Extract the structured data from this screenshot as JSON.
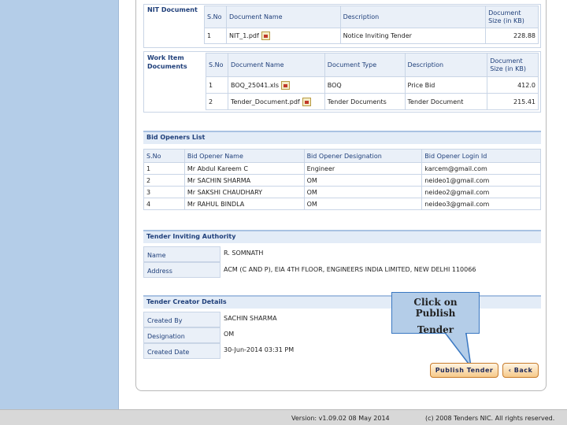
{
  "nit_document": {
    "section_label": "NIT Document",
    "headers": [
      "S.No",
      "Document Name",
      "Description",
      "Document Size (in KB)"
    ],
    "rows": [
      {
        "sno": "1",
        "name": "NIT_1.pdf",
        "description": "Notice Inviting Tender",
        "size": "228.88"
      }
    ]
  },
  "work_item_documents": {
    "section_label": "Work Item Documents",
    "headers": [
      "S.No",
      "Document Name",
      "Document Type",
      "Description",
      "Document Size (in KB)"
    ],
    "rows": [
      {
        "sno": "1",
        "name": "BOQ_25041.xls",
        "type": "BOQ",
        "description": "Price Bid",
        "size": "412.0"
      },
      {
        "sno": "2",
        "name": "Tender_Document.pdf",
        "type": "Tender Documents",
        "description": "Tender Document",
        "size": "215.41"
      }
    ]
  },
  "bid_openers": {
    "title": "Bid Openers List",
    "headers": [
      "S.No",
      "Bid Opener Name",
      "Bid Opener Designation",
      "Bid Opener Login Id"
    ],
    "rows": [
      {
        "sno": "1",
        "name": "Mr Abdul Kareem C",
        "designation": "Engineer",
        "login": "karcem@gmail.com"
      },
      {
        "sno": "2",
        "name": "Mr SACHIN SHARMA",
        "designation": "OM",
        "login": "neideo1@gmail.com"
      },
      {
        "sno": "3",
        "name": "Mr SAKSHI CHAUDHARY",
        "designation": "OM",
        "login": "neideo2@gmail.com"
      },
      {
        "sno": "4",
        "name": "Mr RAHUL BINDLA",
        "designation": "OM",
        "login": "neideo3@gmail.com"
      }
    ]
  },
  "tender_inviting_authority": {
    "title": "Tender Inviting Authority",
    "name_label": "Name",
    "name_value": "R. SOMNATH",
    "address_label": "Address",
    "address_value": "ACM (C AND P), EIA 4TH FLOOR, ENGINEERS INDIA LIMITED, NEW DELHI 110066"
  },
  "tender_creator": {
    "title": "Tender Creator Details",
    "created_by_label": "Created By",
    "created_by_value": "SACHIN SHARMA",
    "designation_label": "Designation",
    "designation_value": "OM",
    "created_date_label": "Created Date",
    "created_date_value": "30-Jun-2014 03:31 PM"
  },
  "callout": {
    "line1": "Click on Publish",
    "line2": "Tender"
  },
  "actions": {
    "publish_label": "Publish Tender",
    "back_label": "Back"
  },
  "footer": {
    "version": "Version: v1.09.02 08 May 2014",
    "copyright": "(c) 2008 Tenders NIC. All rights reserved."
  },
  "colors": {
    "accent": "#1f3f7a",
    "rail": "#b4cde8",
    "button": "#f6c98a"
  }
}
